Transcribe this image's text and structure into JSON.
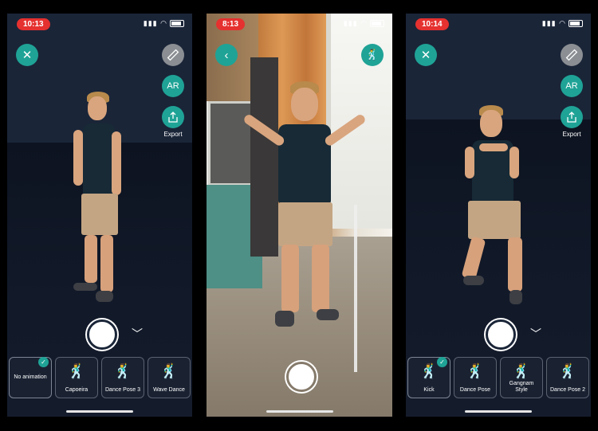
{
  "screens": [
    {
      "status_time": "10:13",
      "export_label": "Export",
      "ar_label": "AR",
      "animations": [
        {
          "label": "No animation",
          "selected": true
        },
        {
          "label": "Capoeira",
          "selected": false
        },
        {
          "label": "Dance Pose 3",
          "selected": false
        },
        {
          "label": "Wave Dance",
          "selected": false
        }
      ]
    },
    {
      "status_time": "8:13"
    },
    {
      "status_time": "10:14",
      "export_label": "Export",
      "ar_label": "AR",
      "animations": [
        {
          "label": "Kick",
          "selected": true
        },
        {
          "label": "Dance Pose",
          "selected": false
        },
        {
          "label": "Gangnam Style",
          "selected": false
        },
        {
          "label": "Dance Pose 2",
          "selected": false
        }
      ]
    }
  ],
  "icons": {
    "close": "close-icon",
    "ruler": "ruler-icon",
    "share": "share-icon",
    "back": "back-icon",
    "animate": "dancer-icon",
    "check": "checkmark-icon",
    "chevron": "chevron-down-icon"
  },
  "colors": {
    "accent": "#1fa396",
    "time_badge": "#e5312f",
    "dark_bg": "#111a2a"
  }
}
